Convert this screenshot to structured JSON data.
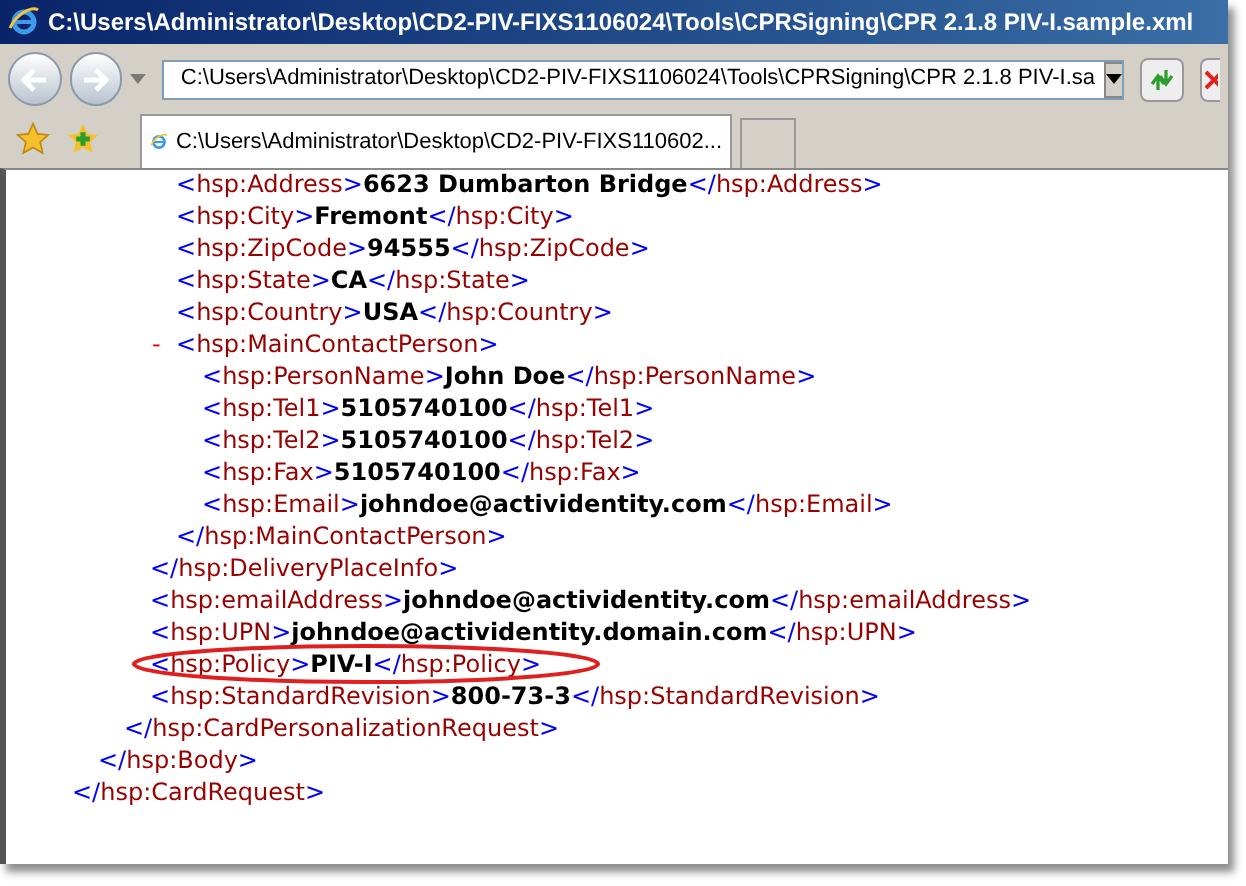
{
  "window": {
    "title": "C:\\Users\\Administrator\\Desktop\\CD2-PIV-FIXS1106024\\Tools\\CPRSigning\\CPR 2.1.8 PIV-I.sample.xml"
  },
  "address_bar": {
    "value": "C:\\Users\\Administrator\\Desktop\\CD2-PIV-FIXS1106024\\Tools\\CPRSigning\\CPR 2.1.8 PIV-I.sa"
  },
  "tabs": [
    {
      "label": "C:\\Users\\Administrator\\Desktop\\CD2-PIV-FIXS110602...",
      "selected": true
    }
  ],
  "document": {
    "tree": [
      {
        "kind": "container",
        "close": [
          "</",
          "hsp:CardRequest",
          ">"
        ],
        "children": [
          {
            "kind": "container",
            "close": [
              "</",
              "hsp:Body",
              ">"
            ],
            "children": [
              {
                "kind": "container",
                "close": [
                  "</",
                  "hsp:CardPersonalizationRequest",
                  ">"
                ],
                "children": [
                  {
                    "kind": "container",
                    "close": [
                      "</",
                      "hsp:DeliveryPlaceInfo",
                      ">"
                    ],
                    "children": [
                      {
                        "kind": "leaf",
                        "open": [
                          "<",
                          "hsp:Address",
                          ">"
                        ],
                        "value": "6623 Dumbarton Bridge",
                        "close": [
                          "</",
                          "hsp:Address",
                          ">"
                        ],
                        "highlighted": false
                      },
                      {
                        "kind": "leaf",
                        "open": [
                          "<",
                          "hsp:City",
                          ">"
                        ],
                        "value": "Fremont",
                        "close": [
                          "</",
                          "hsp:City",
                          ">"
                        ],
                        "highlighted": false
                      },
                      {
                        "kind": "leaf",
                        "open": [
                          "<",
                          "hsp:ZipCode",
                          ">"
                        ],
                        "value": "94555",
                        "close": [
                          "</",
                          "hsp:ZipCode",
                          ">"
                        ],
                        "highlighted": false
                      },
                      {
                        "kind": "leaf",
                        "open": [
                          "<",
                          "hsp:State",
                          ">"
                        ],
                        "value": "CA",
                        "close": [
                          "</",
                          "hsp:State",
                          ">"
                        ],
                        "highlighted": false
                      },
                      {
                        "kind": "leaf",
                        "open": [
                          "<",
                          "hsp:Country",
                          ">"
                        ],
                        "value": "USA",
                        "close": [
                          "</",
                          "hsp:Country",
                          ">"
                        ],
                        "highlighted": false
                      },
                      {
                        "kind": "container",
                        "toggle": "-",
                        "open": [
                          "<",
                          "hsp:MainContactPerson",
                          ">"
                        ],
                        "close": [
                          "</",
                          "hsp:MainContactPerson",
                          ">"
                        ],
                        "children": [
                          {
                            "kind": "leaf",
                            "open": [
                              "<",
                              "hsp:PersonName",
                              ">"
                            ],
                            "value": "John Doe",
                            "close": [
                              "</",
                              "hsp:PersonName",
                              ">"
                            ],
                            "highlighted": false
                          },
                          {
                            "kind": "leaf",
                            "open": [
                              "<",
                              "hsp:Tel1",
                              ">"
                            ],
                            "value": "5105740100",
                            "close": [
                              "</",
                              "hsp:Tel1",
                              ">"
                            ],
                            "highlighted": false
                          },
                          {
                            "kind": "leaf",
                            "open": [
                              "<",
                              "hsp:Tel2",
                              ">"
                            ],
                            "value": "5105740100",
                            "close": [
                              "</",
                              "hsp:Tel2",
                              ">"
                            ],
                            "highlighted": false
                          },
                          {
                            "kind": "leaf",
                            "open": [
                              "<",
                              "hsp:Fax",
                              ">"
                            ],
                            "value": "5105740100",
                            "close": [
                              "</",
                              "hsp:Fax",
                              ">"
                            ],
                            "highlighted": false
                          },
                          {
                            "kind": "leaf",
                            "open": [
                              "<",
                              "hsp:Email",
                              ">"
                            ],
                            "value": "johndoe@actividentity.com",
                            "close": [
                              "</",
                              "hsp:Email",
                              ">"
                            ],
                            "highlighted": false
                          }
                        ]
                      }
                    ]
                  },
                  {
                    "kind": "leaf",
                    "open": [
                      "<",
                      "hsp:emailAddress",
                      ">"
                    ],
                    "value": "johndoe@actividentity.com",
                    "close": [
                      "</",
                      "hsp:emailAddress",
                      ">"
                    ],
                    "highlighted": false
                  },
                  {
                    "kind": "leaf",
                    "open": [
                      "<",
                      "hsp:UPN",
                      ">"
                    ],
                    "value": "johndoe@actividentity.domain.com",
                    "close": [
                      "</",
                      "hsp:UPN",
                      ">"
                    ],
                    "highlighted": false
                  },
                  {
                    "kind": "leaf",
                    "open": [
                      "<",
                      "hsp:Policy",
                      ">"
                    ],
                    "value": "PIV-I",
                    "close": [
                      "</",
                      "hsp:Policy",
                      ">"
                    ],
                    "highlighted": true
                  },
                  {
                    "kind": "leaf",
                    "open": [
                      "<",
                      "hsp:StandardRevision",
                      ">"
                    ],
                    "value": "800-73-3",
                    "close": [
                      "</",
                      "hsp:StandardRevision",
                      ">"
                    ],
                    "highlighted": false
                  }
                ]
              }
            ]
          }
        ]
      }
    ]
  }
}
